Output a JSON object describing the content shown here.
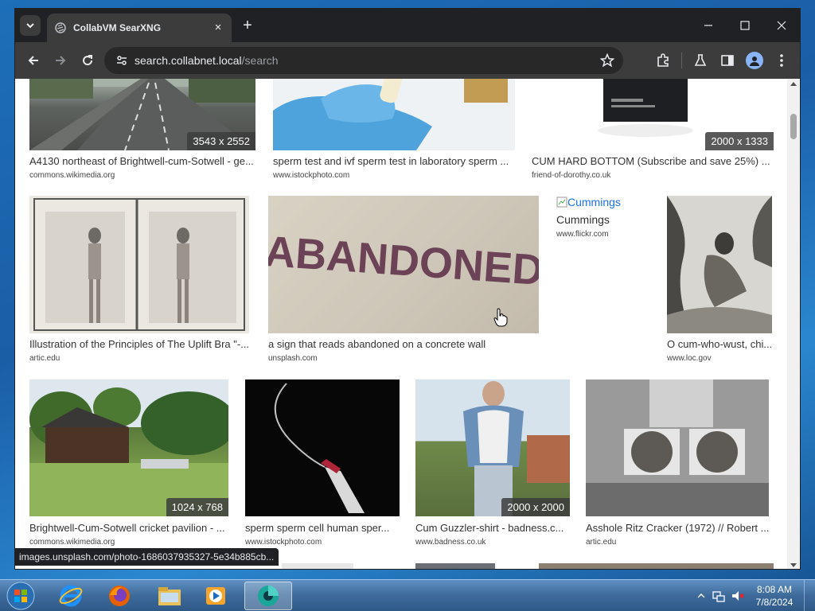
{
  "browser": {
    "tab_title": "CollabVM SearXNG",
    "tab_close": "×",
    "new_tab": "+",
    "url_host": "search.collabnet.local",
    "url_path": "/search",
    "status_url": "images.unsplash.com/photo-1686037935327-5e34b885cb..."
  },
  "results_row1": [
    {
      "title": "A4130 northeast of Brightwell-cum-Sotwell - ge...",
      "url": "commons.wikimedia.org",
      "resolution": "3543 x 2552"
    },
    {
      "title": "sperm test and ivf sperm test in laboratory sperm ...",
      "url": "www.istockphoto.com",
      "resolution": ""
    },
    {
      "title": "CUM HARD BOTTOM (Subscribe and save 25%) ...",
      "url": "friend-of-dorothy.co.uk",
      "resolution": "2000 x 1333"
    }
  ],
  "results_row2": [
    {
      "title": "Illustration of the Principles of The Uplift Bra \"-...",
      "url": "artic.edu"
    },
    {
      "title": "a sign that reads abandoned on a concrete wall",
      "url": "unsplash.com",
      "image_text": "ABANDONED"
    },
    {
      "title": "Cummings",
      "url": "www.flickr.com",
      "broken_alt": "Cummings"
    },
    {
      "title": "O cum-who-wust, chi...",
      "url": "www.loc.gov"
    }
  ],
  "results_row3": [
    {
      "title": "Brightwell-Cum-Sotwell cricket pavilion - ...",
      "url": "commons.wikimedia.org",
      "resolution": "1024 x 768"
    },
    {
      "title": "sperm sperm cell human sper...",
      "url": "www.istockphoto.com",
      "resolution": ""
    },
    {
      "title": "Cum Guzzler-shirt - badness.c...",
      "url": "www.badness.co.uk",
      "resolution": "2000 x 2000"
    },
    {
      "title": "Asshole Ritz Cracker (1972) // Robert ...",
      "url": "artic.edu",
      "resolution": ""
    }
  ],
  "taskbar": {
    "time": "8:08 AM",
    "date": "7/8/2024"
  }
}
